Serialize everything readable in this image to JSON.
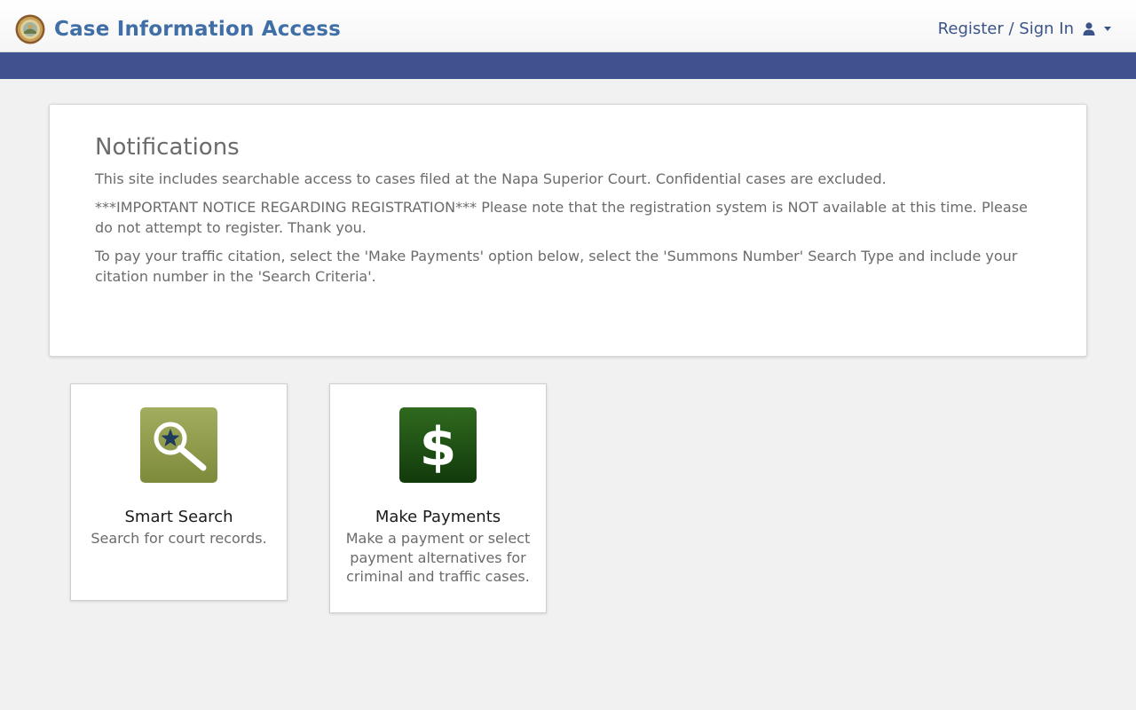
{
  "header": {
    "title": "Case Information Access",
    "signin_label": "Register / Sign In",
    "seal_icon": "court-seal-icon",
    "user_icon": "user-icon"
  },
  "colors": {
    "title": "#3f6fa6",
    "navband": "#40518f",
    "search_tile": "#8f9a4a",
    "pay_tile": "#1f4a12"
  },
  "notifications": {
    "heading": "Notifications",
    "paragraphs": [
      "This site includes searchable access to cases filed at the Napa Superior Court. Confidential cases are excluded.",
      "***IMPORTANT NOTICE REGARDING REGISTRATION*** Please note that the registration system is NOT available at this time. Please do not attempt to register. Thank you.",
      "To pay your traffic citation, select the 'Make Payments' option below, select the 'Summons Number' Search Type and include your citation number in the 'Search Criteria'."
    ]
  },
  "tiles": [
    {
      "title": "Smart Search",
      "description": "Search for court records.",
      "icon": "magnifier-star-icon"
    },
    {
      "title": "Make Payments",
      "description": "Make a payment or select payment alternatives for criminal and traffic cases.",
      "icon": "dollar-sign-icon"
    }
  ]
}
